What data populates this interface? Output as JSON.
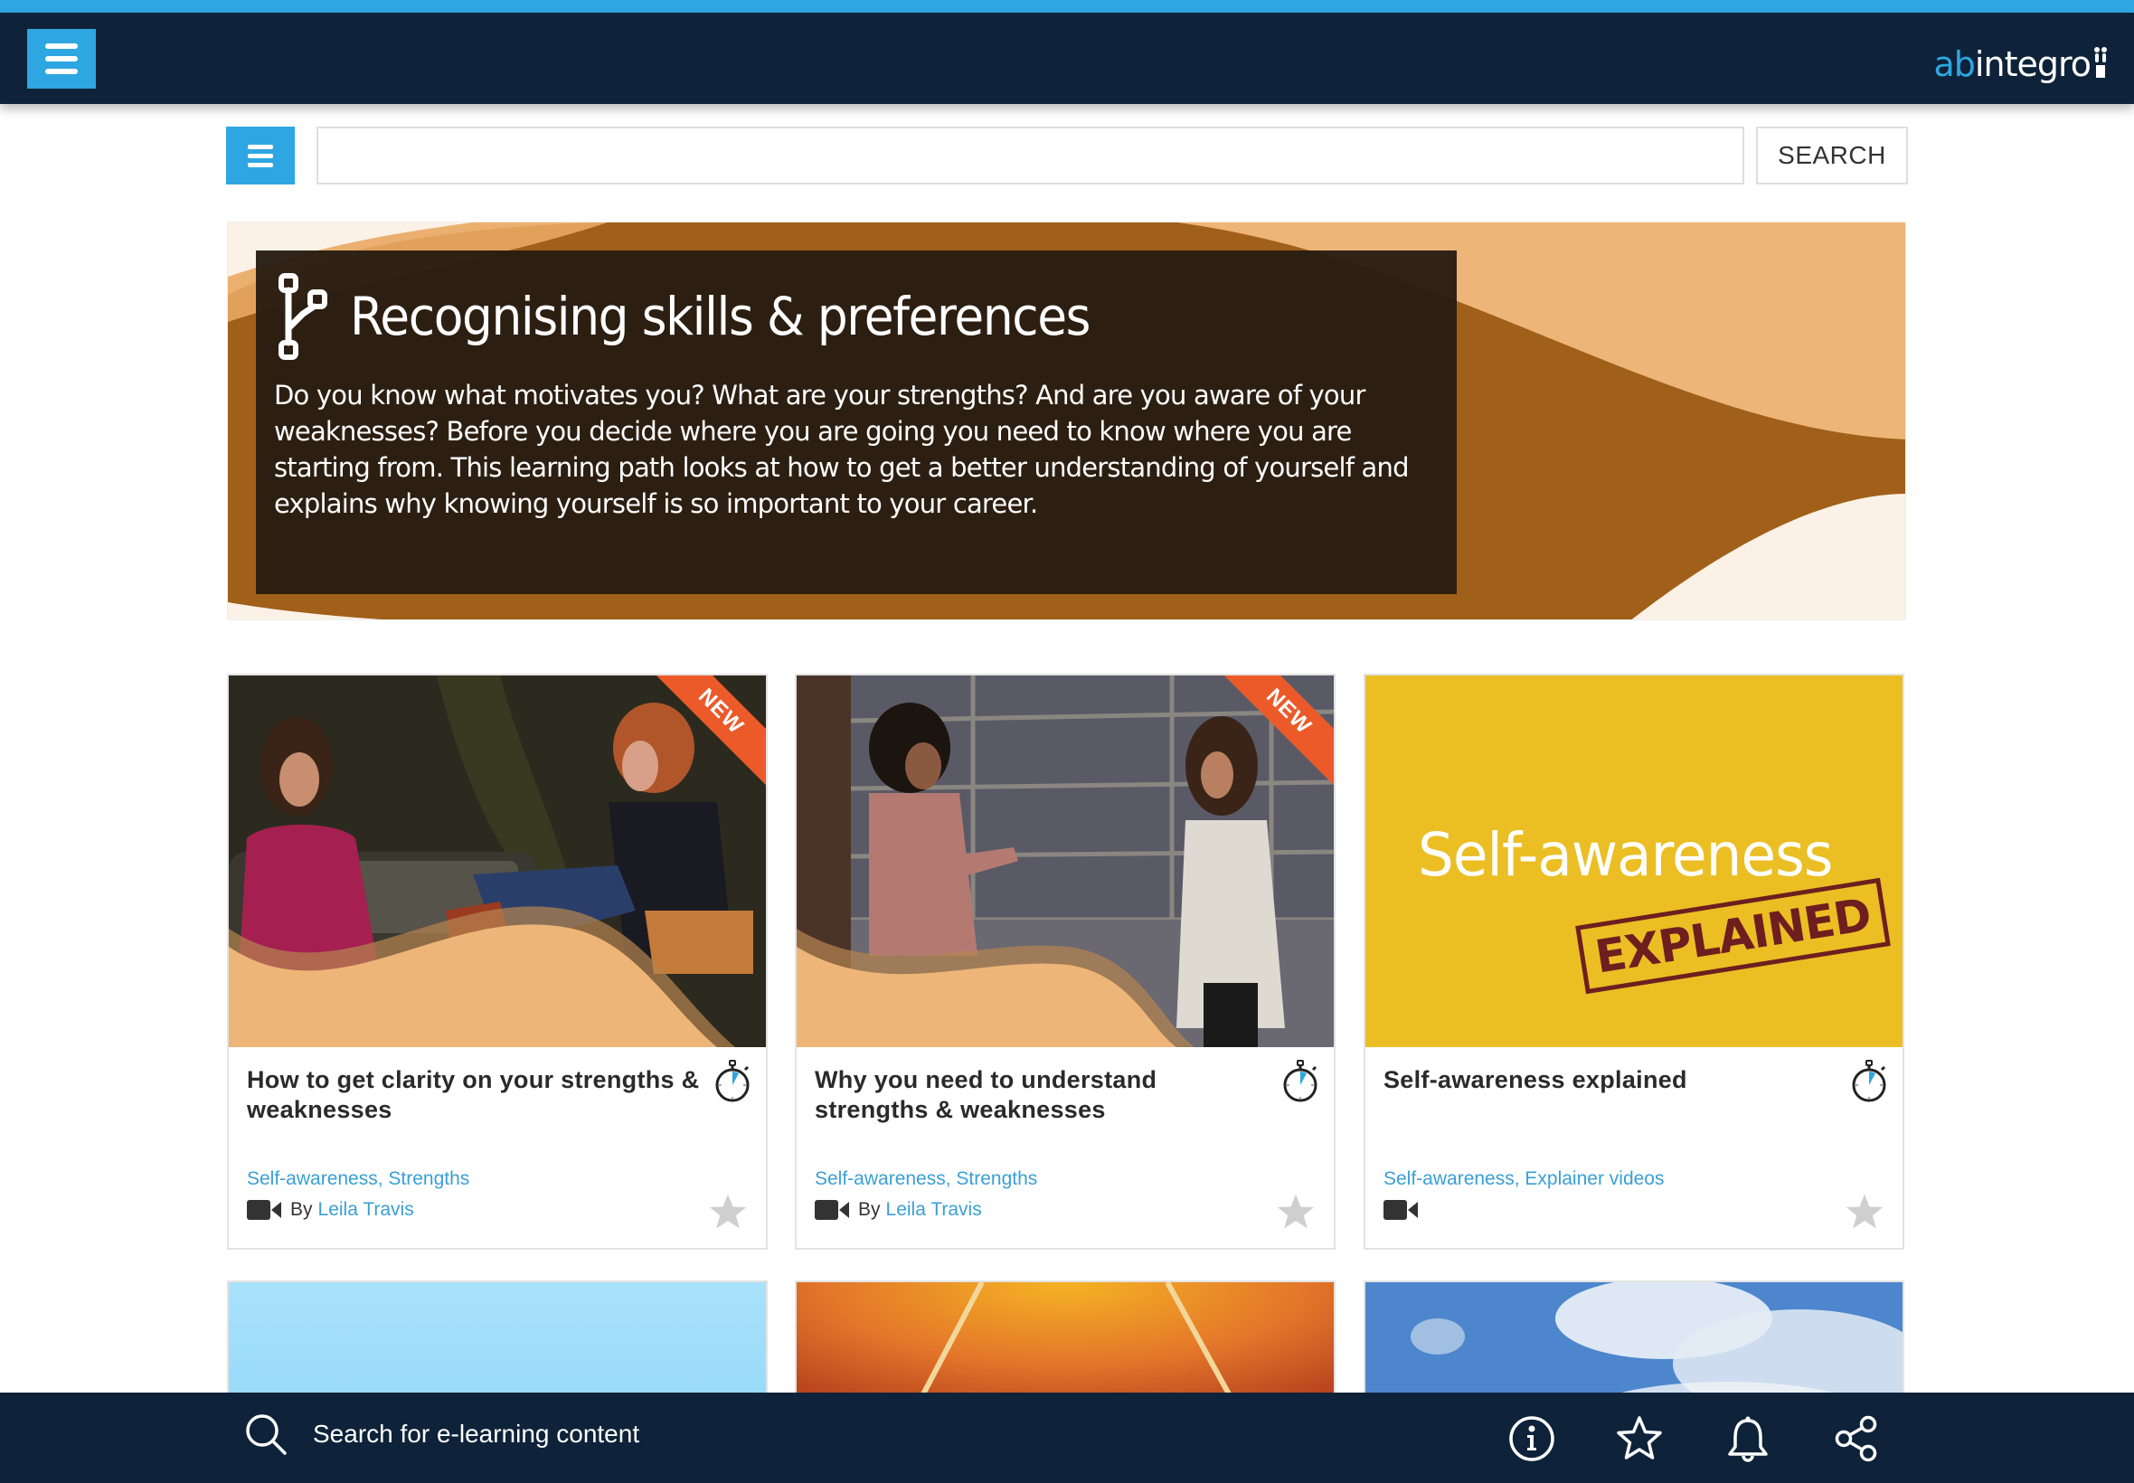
{
  "header": {
    "logo_part1": "ab",
    "logo_part2": "integro",
    "menu_icon": "hamburger-icon"
  },
  "search": {
    "menu_icon": "list-icon",
    "input_value": "",
    "input_placeholder": "",
    "button_label": "SEARCH"
  },
  "banner": {
    "icon": "learning-path-icon",
    "title": "Recognising skills & preferences",
    "description": "Do you know what motivates you? What are your strengths? And are you aware of your weaknesses? Before you decide where you are going you need to know where you are starting from. This learning path looks at how to get a better understanding of yourself and explains why knowing yourself is so important to your career."
  },
  "cards": [
    {
      "title": "How to get clarity on your strengths & weaknesses",
      "badge": "NEW",
      "tags": "Self-awareness, Strengths",
      "by_label": "By",
      "author": "Leila Travis",
      "type_icon": "video-camera-icon",
      "duration_icon": "stopwatch-icon"
    },
    {
      "title": "Why you need to understand strengths & weaknesses",
      "badge": "NEW",
      "tags": "Self-awareness, Strengths",
      "by_label": "By",
      "author": "Leila Travis",
      "type_icon": "video-camera-icon",
      "duration_icon": "stopwatch-icon"
    },
    {
      "title": "Self-awareness explained",
      "badge": "",
      "image_text_1": "Self-awareness",
      "image_text_2": "EXPLAINED",
      "tags": "Self-awareness, Explainer videos",
      "by_label": "",
      "author": "",
      "type_icon": "video-camera-icon",
      "duration_icon": "stopwatch-icon"
    }
  ],
  "footer": {
    "search_label": "Search for e-learning content",
    "icons": [
      "info-icon",
      "star-icon",
      "bell-icon",
      "share-icon"
    ]
  },
  "colors": {
    "accent_blue": "#2ea6e1",
    "header_navy": "#0e2339",
    "link_blue": "#3a9fd5",
    "new_badge": "#ec5a2a",
    "banner_brown": "#a0601a",
    "banner_peach": "#edb577"
  }
}
